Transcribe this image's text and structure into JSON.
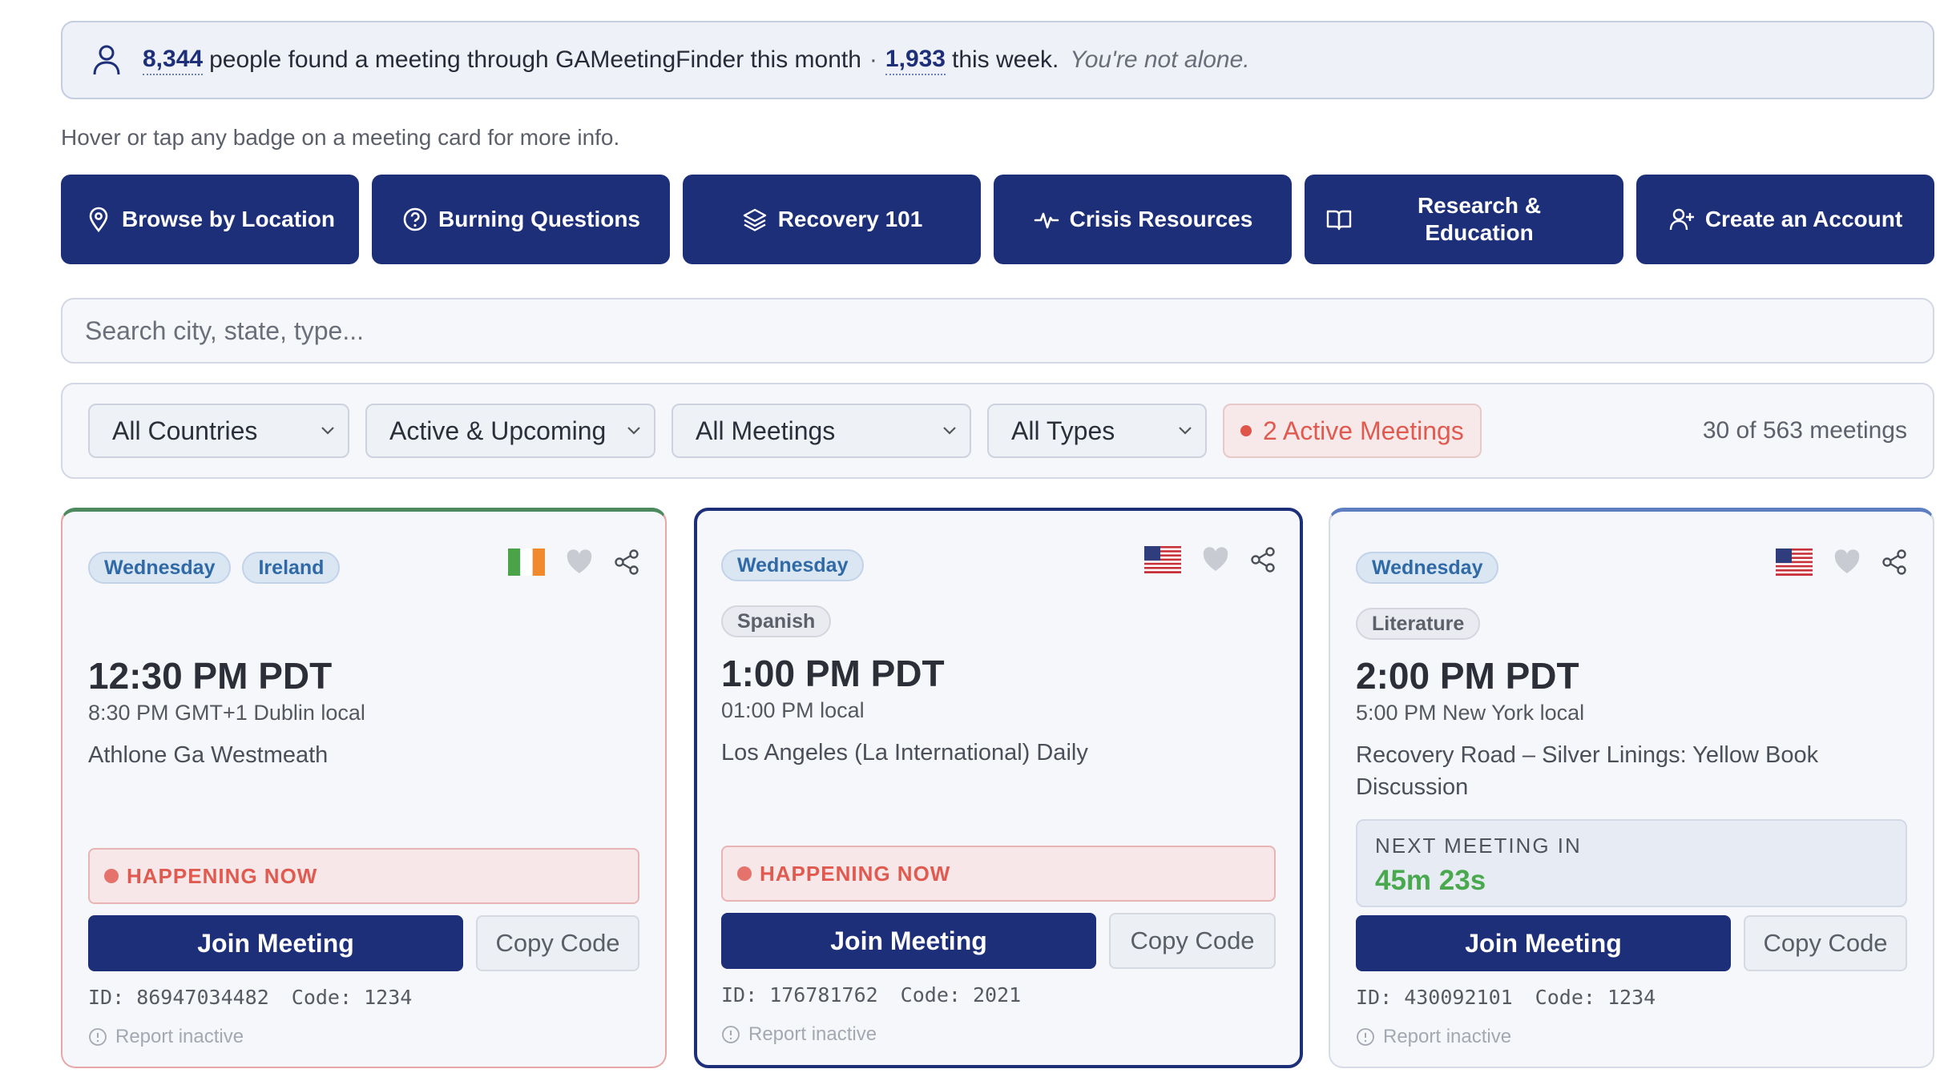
{
  "banner": {
    "month_count": "8,344",
    "month_text": "people found a meeting through GAMeetingFinder this month",
    "separator": "·",
    "week_count": "1,933",
    "week_text": "this week.",
    "tagline": "You're not alone."
  },
  "hint": "Hover or tap any badge on a meeting card for more info.",
  "nav": [
    {
      "label": "Browse by Location",
      "icon": "location-pin-icon"
    },
    {
      "label": "Burning Questions",
      "icon": "question-circle-icon"
    },
    {
      "label": "Recovery 101",
      "icon": "layers-icon"
    },
    {
      "label": "Crisis Resources",
      "icon": "pulse-icon"
    },
    {
      "label": "Research & Education",
      "icon": "book-icon"
    },
    {
      "label": "Create an Account",
      "icon": "user-plus-icon"
    }
  ],
  "search": {
    "placeholder": "Search city, state, type...",
    "value": ""
  },
  "filters": {
    "country": "All Countries",
    "status": "Active & Upcoming",
    "meetings": "All Meetings",
    "types": "All Types",
    "active_label": "2 Active Meetings",
    "count": "30 of 563 meetings"
  },
  "cards": [
    {
      "tags": [
        "Wednesday",
        "Ireland"
      ],
      "flag": "ireland-flag",
      "time": "12:30 PM PDT",
      "local": "8:30 PM GMT+1 Dublin local",
      "name": "Athlone Ga Westmeath",
      "status": "HAPPENING NOW",
      "join": "Join Meeting",
      "copy": "Copy Code",
      "id_text": "ID: 86947034482",
      "code_text": "Code: 1234",
      "report": "Report inactive"
    },
    {
      "tags": [
        "Wednesday"
      ],
      "tag2": "Spanish",
      "flag": "usa-flag",
      "time": "1:00 PM PDT",
      "local": "01:00 PM local",
      "name": "Los Angeles (La International) Daily",
      "status": "HAPPENING NOW",
      "join": "Join Meeting",
      "copy": "Copy Code",
      "id_text": "ID: 176781762",
      "code_text": "Code: 2021",
      "report": "Report inactive"
    },
    {
      "tags": [
        "Wednesday"
      ],
      "tag2": "Literature",
      "flag": "usa-flag",
      "time": "2:00 PM PDT",
      "local": "5:00 PM New York local",
      "name": "Recovery Road – Silver Linings: Yellow Book Discussion",
      "next_label": "NEXT MEETING IN",
      "next_value": "45m 23s",
      "join": "Join Meeting",
      "copy": "Copy Code",
      "id_text": "ID: 430092101",
      "code_text": "Code: 1234",
      "report": "Report inactive"
    }
  ],
  "colors": {
    "primary": "#1e2f7a",
    "live": "#e05a4f",
    "countdown": "#4aa84f"
  }
}
